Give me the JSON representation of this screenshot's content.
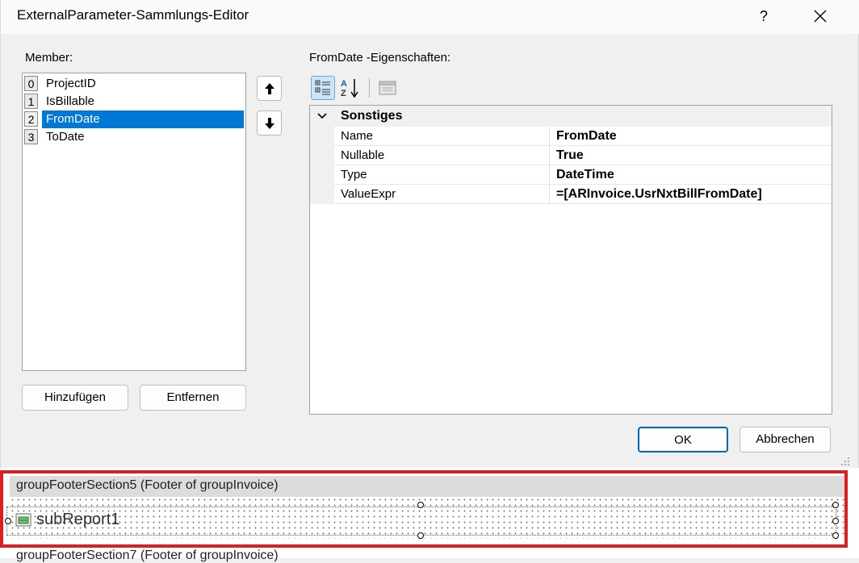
{
  "window": {
    "title": "ExternalParameter-Sammlungs-Editor",
    "help_label": "?"
  },
  "members": {
    "label": "Member:",
    "items": [
      {
        "index": "0",
        "name": "ProjectID"
      },
      {
        "index": "1",
        "name": "IsBillable"
      },
      {
        "index": "2",
        "name": "FromDate"
      },
      {
        "index": "3",
        "name": "ToDate"
      }
    ],
    "selected_index": 2,
    "add_label": "Hinzufügen",
    "remove_label": "Entfernen"
  },
  "properties": {
    "label": "FromDate -Eigenschaften:",
    "category": "Sonstiges",
    "rows": [
      {
        "name": "Name",
        "value": "FromDate"
      },
      {
        "name": "Nullable",
        "value": "True"
      },
      {
        "name": "Type",
        "value": "DateTime"
      },
      {
        "name": "ValueExpr",
        "value": "=[ARInvoice.UsrNxtBillFromDate]"
      }
    ]
  },
  "footer": {
    "ok_label": "OK",
    "cancel_label": "Abbrechen"
  },
  "designer": {
    "section5_label": "groupFooterSection5 (Footer of groupInvoice)",
    "subreport_label": "subReport1",
    "section7_label": "groupFooterSection7 (Footer of groupInvoice)"
  },
  "colors": {
    "selection": "#0078d7",
    "highlight_border": "#e01e1e"
  }
}
